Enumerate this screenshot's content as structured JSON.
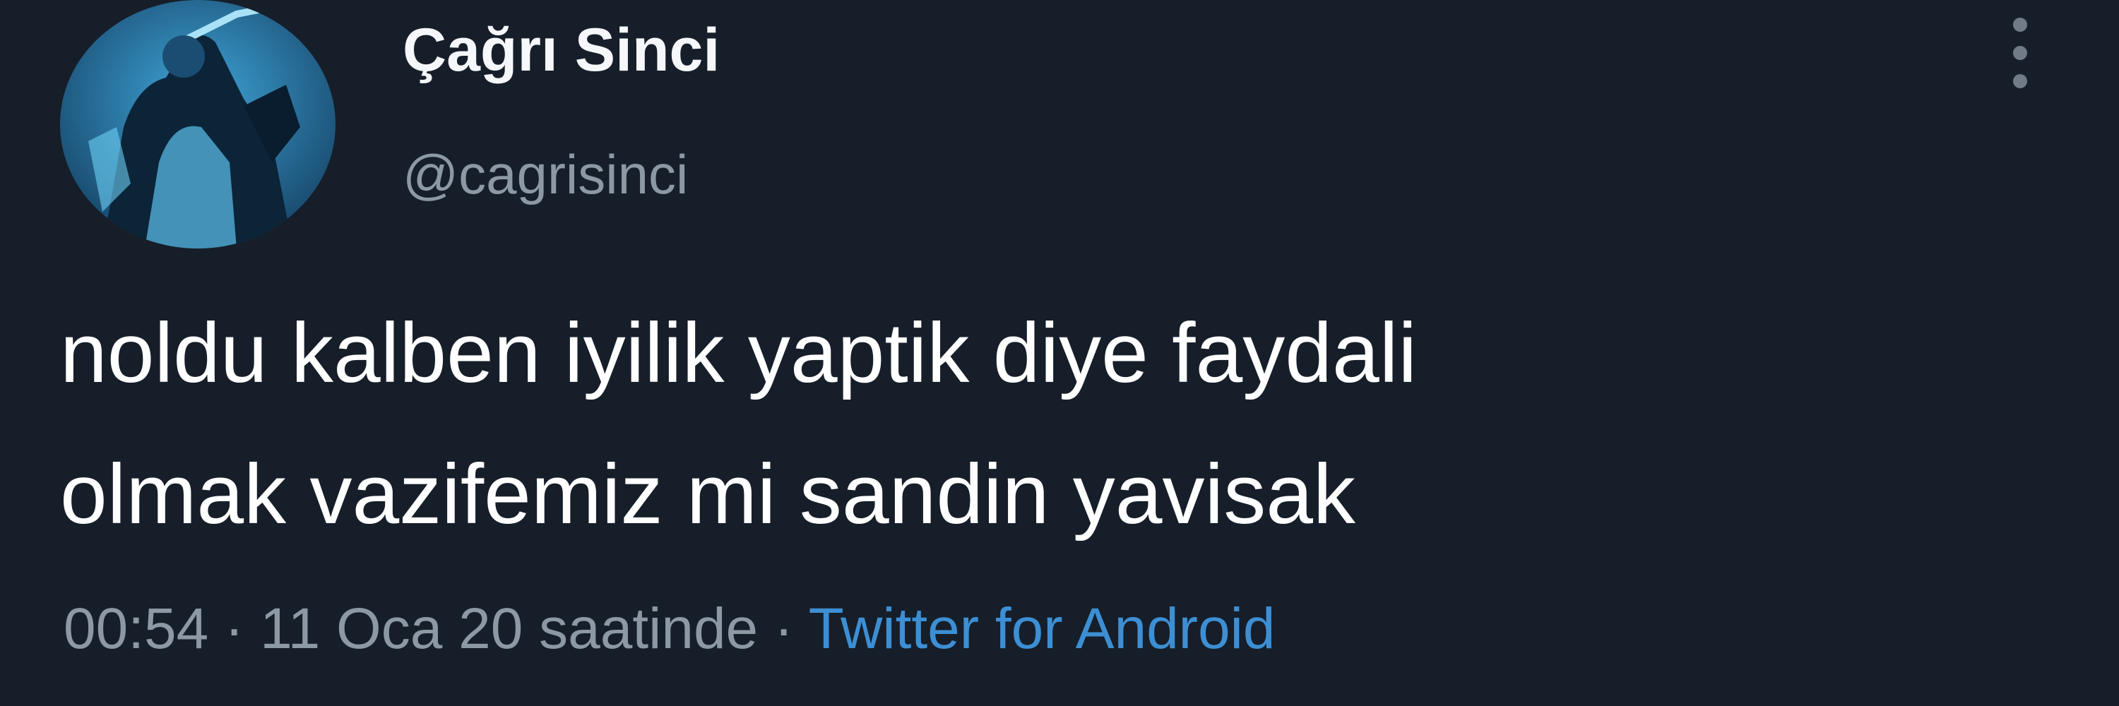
{
  "tweet": {
    "author": {
      "display_name": "Çağrı Sinci",
      "handle": "@cagrisinci",
      "avatar_icon": "profile-photo"
    },
    "more_icon": "vertical-ellipsis-icon",
    "text_lines": [
      "noldu kalben iyilik yaptik diye faydali",
      "olmak vazifemiz mi sandin yavisak"
    ],
    "meta": {
      "time": "00:54",
      "separator": " · ",
      "date": "11 Oca 20 saatinde",
      "source": "Twitter for Android"
    }
  },
  "colors": {
    "background": "#161e29",
    "text": "#ffffff",
    "secondary": "#8d98a5",
    "link": "#3d8fd4"
  }
}
